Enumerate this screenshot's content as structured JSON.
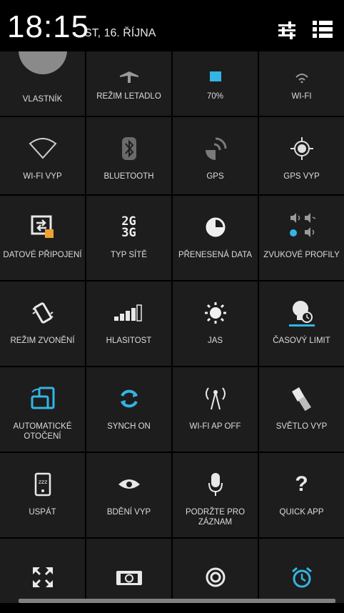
{
  "status": {
    "time": "18:15",
    "date": "ST, 16. ŘÍJNA"
  },
  "header_icons": [
    "settings-sliders-icon",
    "list-icon"
  ],
  "colors": {
    "accent": "#33b5e5",
    "tile_bg": "#1d1d1d"
  },
  "tiles": {
    "owner": "VLASTNÍK",
    "airplane": "REŽIM LETADLO",
    "battery": "70%",
    "wifi_top": "WI-FI",
    "wifi_off": "WI-FI VYP",
    "bluetooth": "BLUETOOTH",
    "gps": "GPS",
    "gps_off": "GPS VYP",
    "data_conn": "DATOVÉ PŘIPOJENÍ",
    "network_type": "TYP SÍTĚ",
    "network_type_icon_text": "2G 3G",
    "data_usage": "PŘENESENÁ DATA",
    "sound_profiles": "ZVUKOVÉ PROFILY",
    "ring_mode": "REŽIM ZVONĚNÍ",
    "volume": "HLASITOST",
    "brightness": "JAS",
    "timeout": "ČASOVÝ LIMIT",
    "auto_rotate": "AUTOMATICKÉ OTOČENÍ",
    "sync": "SYNCH ON",
    "wifi_ap": "WI-FI AP OFF",
    "flashlight": "SVĚTLO VYP",
    "sleep": "USPÁT",
    "eye": "BDĚNÍ VYP",
    "voice": "PODRŽTE PRO ZÁZNAM",
    "quick_app": "QUICK APP",
    "quick_app_icon": "?"
  }
}
